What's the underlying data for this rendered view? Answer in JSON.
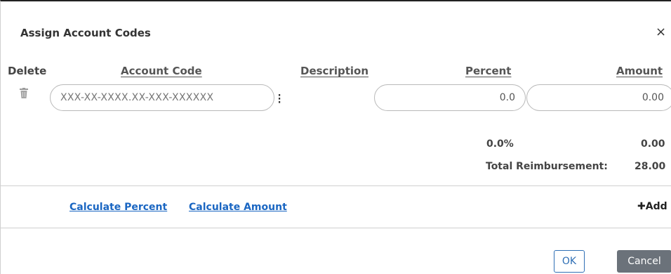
{
  "dialog": {
    "title": "Assign Account Codes",
    "close_glyph": "×"
  },
  "table": {
    "headers": {
      "delete": "Delete",
      "account_code": "Account Code",
      "description": "Description",
      "percent": "Percent",
      "amount": "Amount"
    },
    "rows": [
      {
        "account_code_placeholder": "XXX-XX-XXXX.XX-XXX-XXXXXX",
        "account_code_value": "",
        "percent_value": "0.0",
        "amount_value": "0.00"
      }
    ]
  },
  "totals": {
    "percent": "0.0%",
    "amount": "0.00",
    "reimbursement_label": "Total Reimbursement:",
    "reimbursement_value": "28.00"
  },
  "actions": {
    "calculate_percent": "Calculate Percent",
    "calculate_amount": "Calculate Amount",
    "add": "Add",
    "add_icon": "plus-icon"
  },
  "footer": {
    "ok": "OK",
    "cancel": "Cancel"
  },
  "colors": {
    "link": "#1a66c2",
    "ok_border": "#2f6fb5",
    "cancel_bg": "#6b727a"
  }
}
